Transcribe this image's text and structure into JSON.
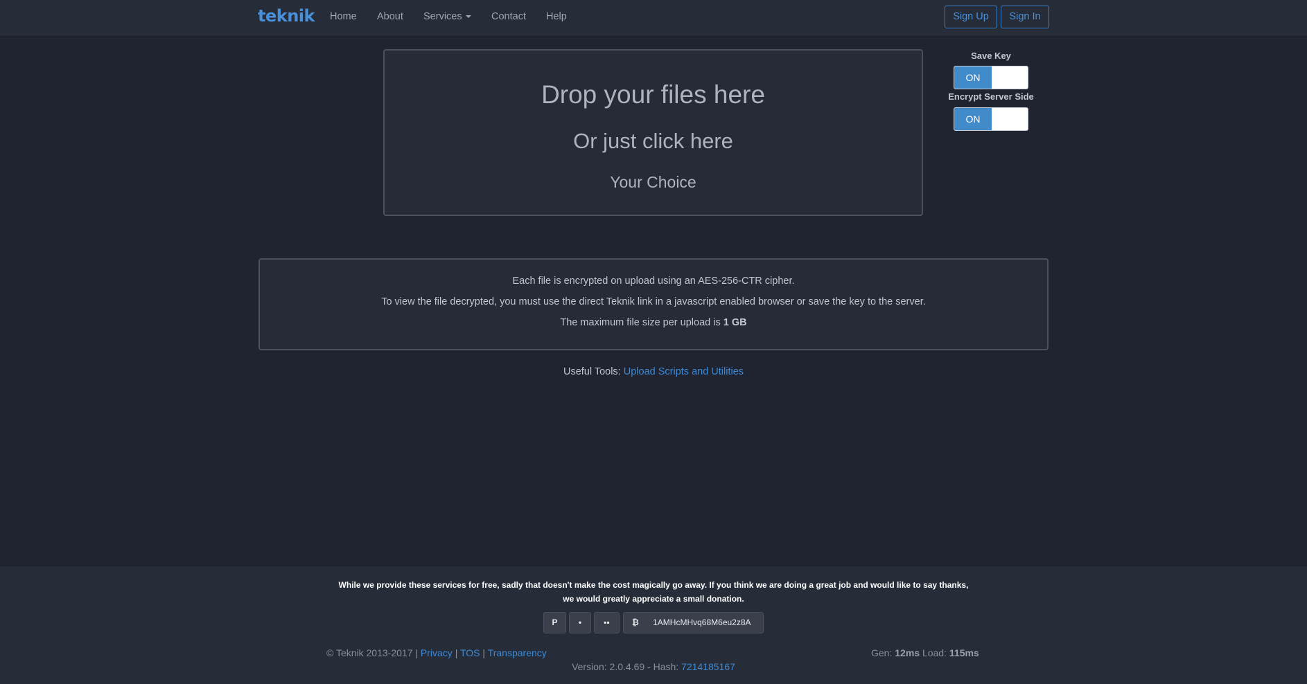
{
  "navbar": {
    "brand": "teknik",
    "items": [
      "Home",
      "About",
      "Services",
      "Contact",
      "Help"
    ],
    "signup": "Sign Up",
    "signin": "Sign In"
  },
  "dropzone": {
    "title": "Drop your files here",
    "subtitle": "Or just click here",
    "choice": "Your Choice"
  },
  "options": {
    "save_key": {
      "label": "Save Key",
      "state": "ON"
    },
    "encrypt_server_side": {
      "label": "Encrypt Server Side",
      "state": "ON"
    }
  },
  "info": {
    "line1": "Each file is encrypted on upload using an AES-256-CTR cipher.",
    "line2": "To view the file decrypted, you must use the direct Teknik link in a javascript enabled browser or save the key to the server.",
    "line3_prefix": "The maximum file size per upload is",
    "line3_value": "1 GB"
  },
  "tools": {
    "prefix": "Useful Tools:",
    "link": "Upload Scripts and Utilities"
  },
  "footer": {
    "donate_text": "While we provide these services for free, sadly that doesn't make the cost magically go away. If you think we are doing a great job and would like to say thanks, we would greatly appreciate a small donation.",
    "donate_buttons": {
      "paypal_icon": "P",
      "flattr_icon": "•",
      "patreon_icon": "▪▪",
      "bitcoin_icon": "₿"
    },
    "bitcoin_address": "1AMHcMHvq68M6eu2z8A",
    "copyright": "© Teknik 2013-2017",
    "sep": "|",
    "privacy": "Privacy",
    "tos": "TOS",
    "transparency": "Transparency",
    "gen_label": "Gen:",
    "gen_value": "12ms",
    "load_label": "Load:",
    "load_value": "115ms",
    "version_prefix": "Version: 2.0.4.69 - Hash:",
    "hash": "7214185167"
  },
  "colors": {
    "background": "#1f2430",
    "navbar": "#272c39",
    "accent": "#428bca",
    "link": "#3d8ad6"
  }
}
